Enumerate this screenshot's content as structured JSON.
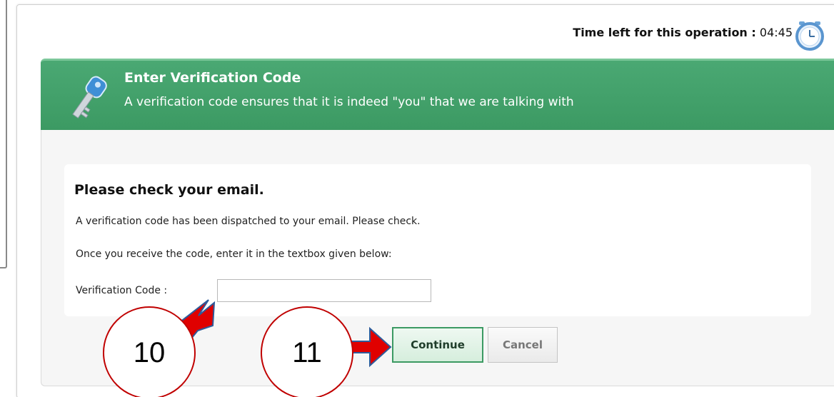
{
  "timer": {
    "label": "Time left for this operation :",
    "value": "04:45",
    "icon": "clock-icon"
  },
  "header": {
    "icon": "key-icon",
    "title": "Enter Verification Code",
    "subtitle": "A verification code ensures that it is indeed \"you\" that we are talking with",
    "color": "#3c9a63"
  },
  "card": {
    "title": "Please check your email.",
    "line1": "A verification code has been dispatched to your email. Please check.",
    "line2": "Once you receive the code, enter it in the textbox given below:",
    "field_label": "Verification Code :",
    "field_value": ""
  },
  "buttons": {
    "continue_label": "Continue",
    "cancel_label": "Cancel"
  },
  "annotations": {
    "step_a": "10",
    "step_b": "11",
    "color": "#e00000"
  }
}
